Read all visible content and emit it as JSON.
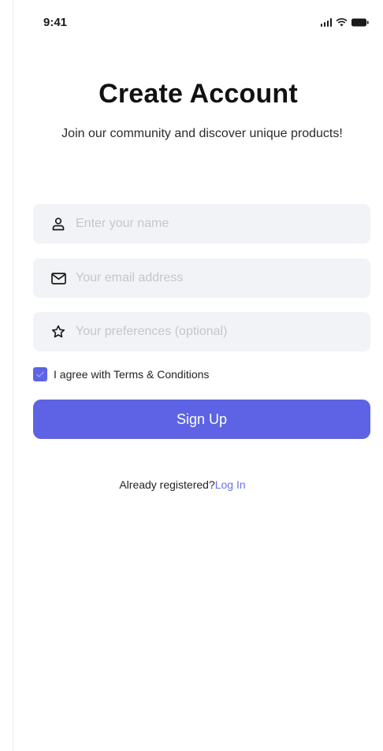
{
  "status_bar": {
    "time": "9:41",
    "icons": [
      "signal-icon",
      "wifi-icon",
      "battery-icon"
    ]
  },
  "header": {
    "title": "Create Account",
    "subtitle": "Join our community and discover unique products!"
  },
  "form": {
    "name": {
      "icon": "user-icon",
      "placeholder": "Enter your name",
      "value": ""
    },
    "email": {
      "icon": "mail-icon",
      "placeholder": "Your email address",
      "value": ""
    },
    "preferences": {
      "icon": "star-icon",
      "placeholder": "Your preferences (optional)",
      "value": ""
    },
    "terms": {
      "label": "I agree with Terms & Conditions",
      "checked": true
    },
    "submit_label": "Sign Up"
  },
  "footer": {
    "prompt": "Already registered?",
    "link_label": "Log In"
  },
  "colors": {
    "accent": "#5D63E4",
    "input_bg": "#F1F3F6",
    "link": "#6B71E8"
  }
}
